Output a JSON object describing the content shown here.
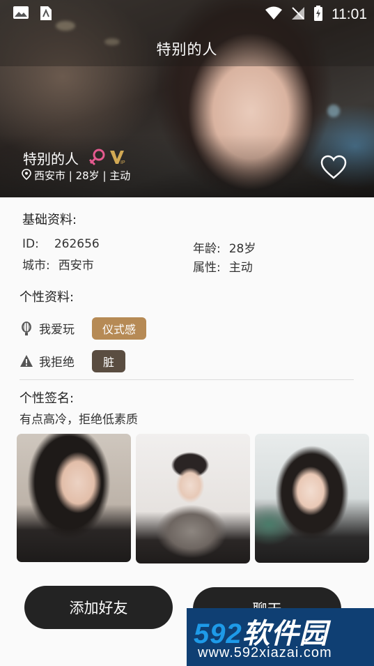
{
  "status_bar": {
    "time": "11:01",
    "left_icons": [
      "image-icon",
      "sim-card-icon"
    ],
    "right_icons": [
      "wifi-icon",
      "no-signal-icon",
      "battery-charging-icon"
    ]
  },
  "header": {
    "title": "特别的人"
  },
  "profile": {
    "name": "特别的人",
    "location_line": "西安市 | 28岁 | 主动",
    "gender": "female",
    "vip": true
  },
  "basic_info": {
    "title": "基础资料:",
    "id_label": "ID:",
    "id_value": "262656",
    "city_label": "城市:",
    "city_value": "西安市",
    "age_label": "年龄:",
    "age_value": "28岁",
    "attr_label": "属性:",
    "attr_value": "主动"
  },
  "personal_info": {
    "title": "个性资料:",
    "like_label": "我爱玩",
    "like_tag": "仪式感",
    "refuse_label": "我拒绝",
    "refuse_tag": "脏"
  },
  "signature": {
    "title": "个性签名:",
    "text": "有点高冷，拒绝低素质"
  },
  "actions": {
    "add_friend": "添加好友",
    "chat": "聊天"
  },
  "watermark": {
    "brand_num": "592",
    "brand_text": "软件园",
    "url": "www.592xiazai.com"
  },
  "colors": {
    "accent_gold": "#b68a55",
    "tag_dark": "#5a4d41",
    "button_bg": "#232323",
    "watermark_bg": "#0f3f73"
  }
}
